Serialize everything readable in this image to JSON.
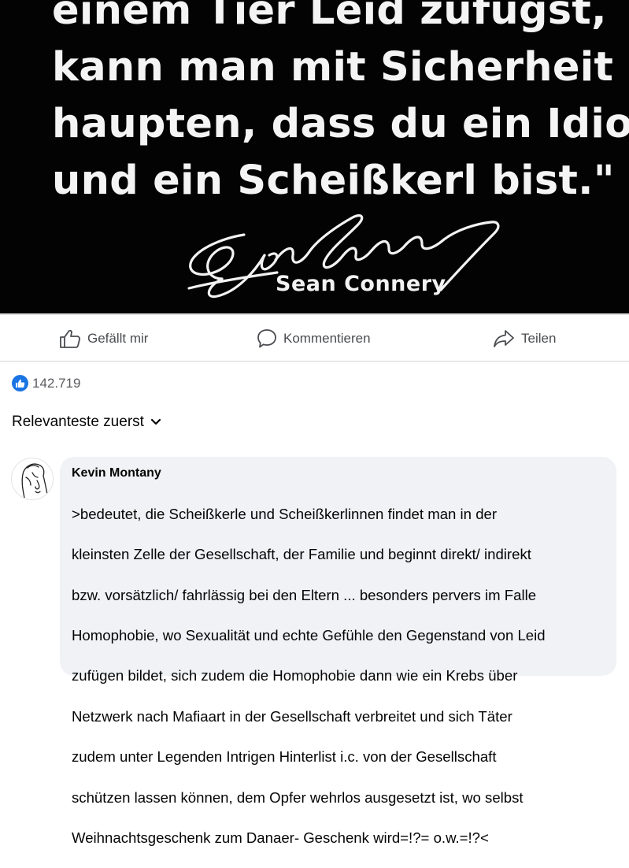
{
  "post": {
    "quote_lines": [
      "einem Tier Leid zufügst,",
      "kann man mit Sicherheit be-",
      "haupten, dass du ein Idiot",
      "und ein Scheißkerl bist.\""
    ],
    "signature_name": "Sean Connery"
  },
  "actions": {
    "like_label": "Gefällt mir",
    "comment_label": "Kommentieren",
    "share_label": "Teilen"
  },
  "reactions": {
    "count": "142.719",
    "icon": "thumbs-up-icon",
    "badge_color": "#1b74e4"
  },
  "sort": {
    "label": "Relevanteste zuerst",
    "icon": "chevron-down-icon"
  },
  "comment": {
    "author": "Kevin Montany",
    "text_lines": [
      ">bedeutet, die Scheißkerle und Scheißkerlinnen findet man in der",
      "kleinsten Zelle der Gesellschaft, der Familie und beginnt direkt/ indirekt",
      "bzw. vorsätzlich/ fahrlässig bei den Eltern  ... besonders pervers im Falle",
      "Homophobie, wo Sexualität und echte Gefühle  den Gegenstand von Leid",
      "zufügen bildet,  sich zudem die Homophobie dann wie ein  Krebs über",
      "Netzwerk nach Mafiaart  in der Gesellschaft verbreitet und sich Täter",
      "zudem unter Legenden Intrigen Hinterlist i.c.   von der Gesellschaft",
      "schützen lassen können, dem Opfer wehrlos ausgesetzt ist, wo selbst",
      "Weihnachtsgeschenk zum Danaer- Geschenk wird=!?= o.w.=!?<"
    ],
    "bubble_color": "#f0f2f5"
  }
}
